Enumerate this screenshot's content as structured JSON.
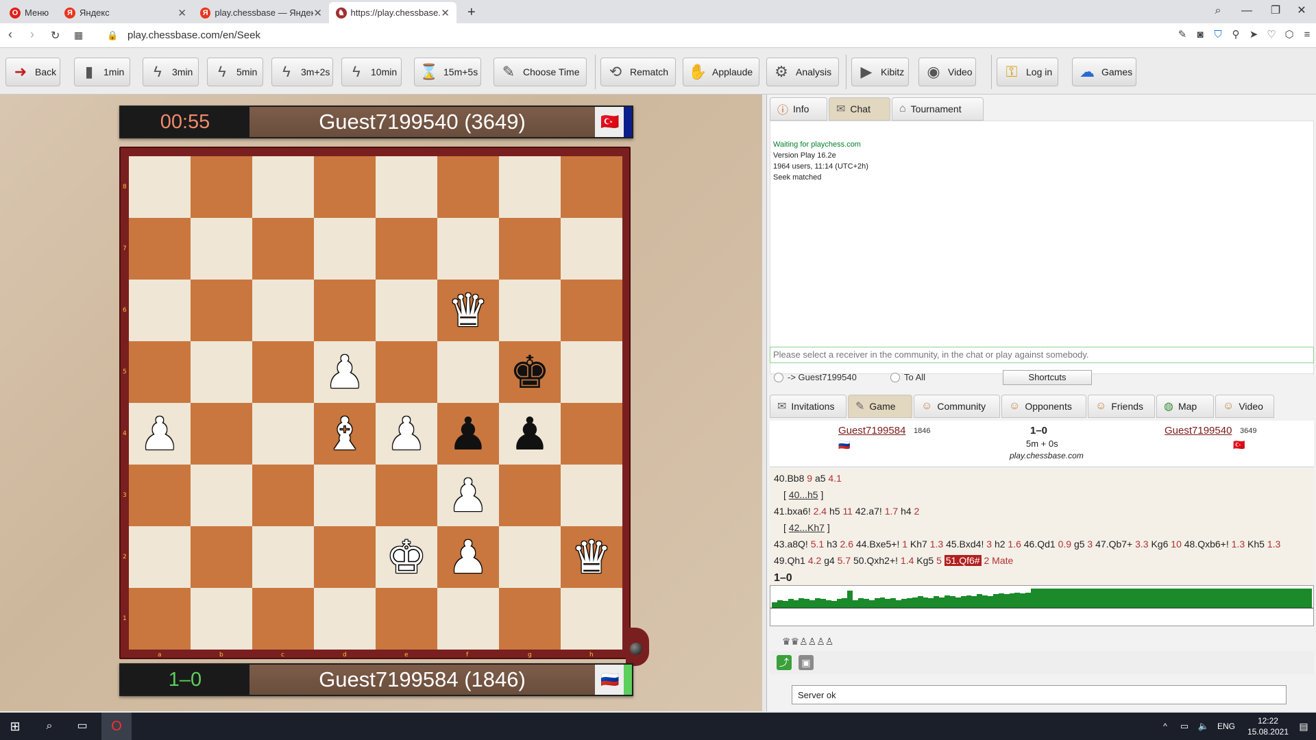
{
  "browser": {
    "menu_label": "Меню",
    "tabs": [
      {
        "label": "Яндекс"
      },
      {
        "label": "play.chessbase — Яндекс: н"
      },
      {
        "label": "https://play.chessbase.com"
      }
    ],
    "url": "play.chessbase.com/en/Seek"
  },
  "toolbar": {
    "back": "Back",
    "t1": "1min",
    "t3": "3min",
    "t5": "5min",
    "t32": "3m+2s",
    "t10": "10min",
    "t15": "15m+5s",
    "choose": "Choose Time",
    "rematch": "Rematch",
    "applaude": "Applaude",
    "analysis": "Analysis",
    "kibitz": "Kibitz",
    "video": "Video",
    "login": "Log in",
    "games": "Games"
  },
  "board": {
    "top_player": {
      "clock": "00:55",
      "name": "Guest7199540 (3649)",
      "flag": "🇹🇷",
      "strip_color": "#0b1f8c",
      "clock_color": "#f08a6a"
    },
    "bottom_player": {
      "clock": "1–0",
      "name": "Guest7199584 (1846)",
      "flag": "🇷🇺",
      "strip_color": "#5ccf5c",
      "clock_color": "#5ccf5c"
    },
    "ranks": [
      "8",
      "7",
      "6",
      "5",
      "4",
      "3",
      "2",
      "1"
    ],
    "files": [
      "a",
      "b",
      "c",
      "d",
      "e",
      "f",
      "g",
      "h"
    ],
    "pieces": [
      {
        "sq": "f6",
        "glyph": "♛",
        "color": "w"
      },
      {
        "sq": "d5",
        "glyph": "♟",
        "color": "w"
      },
      {
        "sq": "g5",
        "glyph": "♚",
        "color": "b"
      },
      {
        "sq": "a4",
        "glyph": "♟",
        "color": "w"
      },
      {
        "sq": "d4",
        "glyph": "♝",
        "color": "w"
      },
      {
        "sq": "e4",
        "glyph": "♟",
        "color": "w"
      },
      {
        "sq": "f4",
        "glyph": "♟",
        "color": "b"
      },
      {
        "sq": "g4",
        "glyph": "♟",
        "color": "b"
      },
      {
        "sq": "f3",
        "glyph": "♟",
        "color": "w"
      },
      {
        "sq": "e2",
        "glyph": "♚",
        "color": "w"
      },
      {
        "sq": "f2",
        "glyph": "♟",
        "color": "w"
      },
      {
        "sq": "h2",
        "glyph": "♛",
        "color": "w"
      }
    ]
  },
  "panel": {
    "tabs": {
      "info": "Info",
      "chat": "Chat",
      "tournament": "Tournament"
    },
    "chat_lines": [
      "Waiting for playchess.com",
      "Version Play 16.2e",
      "1964 users, 11:14 (UTC+2h)",
      "Seek matched"
    ],
    "chat_placeholder": "Please select a receiver in the community, in the chat or play against somebody.",
    "radio_guest": "-> Guest7199540",
    "radio_all": "To All",
    "shortcuts": "Shortcuts",
    "tabs2": {
      "invitations": "Invitations",
      "game": "Game",
      "community": "Community",
      "opponents": "Opponents",
      "friends": "Friends",
      "map": "Map",
      "video": "Video"
    },
    "game": {
      "white": "Guest7199584",
      "white_elo": "1846",
      "black": "Guest7199540",
      "black_elo": "3649",
      "result": "1–0",
      "timecontrol": "5m + 0s",
      "site": "play.chessbase.com"
    },
    "moves": {
      "l1": "40.Bb8",
      "l1e1": "9",
      "l1b": "a5",
      "l1e2": "4.1",
      "v1": "40...h5",
      "l2a": "41.bxa6!",
      "l2e1": "2.4",
      "l2b": "h5",
      "l2e2": "11",
      "l2c": "42.a7!",
      "l2e3": "1.7",
      "l2d": "h4",
      "l2e4": "2",
      "v2": "42...Kh7",
      "l3a": "43.a8Q!",
      "l3e1": "5.1",
      "l3b": "h3",
      "l3e2": "2.6",
      "l3c": "44.Bxe5+!",
      "l3e3": "1",
      "l3d": "Kh7",
      "l3e4": "1.3",
      "l3f": "45.Bxd4!",
      "l3e5": "3",
      "l3g": "h2",
      "l3e6": "1.6",
      "l3h": "46.Qd1",
      "l3e7": "0.9",
      "l3i": "g5",
      "l3e8": "3",
      "l3j": "47.Qb7+",
      "l3e9": "3.3",
      "l3k": "Kg6",
      "l3e10": "10",
      "l3l": "48.Qxb6+!",
      "l3e11": "1.3",
      "l3m": "Kh5",
      "l4e0": "1.3",
      "l4a": "49.Qh1",
      "l4e1": "4.2",
      "l4b": "g4",
      "l4e2": "5.7",
      "l4c": "50.Qxh2+!",
      "l4e3": "1.4",
      "l4d": "Kg5",
      "l4e4": "5",
      "l4cur": "51.Qf6#",
      "l4e5": "2",
      "l4mate": "Mate",
      "result": "1–0"
    },
    "eval_bars": [
      0.3,
      0.4,
      0.35,
      0.45,
      0.4,
      0.5,
      0.45,
      0.4,
      0.5,
      0.45,
      0.4,
      0.35,
      0.45,
      0.5,
      0.9,
      0.4,
      0.5,
      0.45,
      0.4,
      0.5,
      0.55,
      0.45,
      0.5,
      0.4,
      0.45,
      0.5,
      0.55,
      0.6,
      0.55,
      0.5,
      0.6,
      0.55,
      0.65,
      0.6,
      0.55,
      0.6,
      0.65,
      0.6,
      0.7,
      0.65,
      0.6,
      0.7,
      0.75,
      0.7,
      0.75,
      0.8,
      0.75,
      0.8,
      1,
      1,
      1,
      1,
      1,
      1,
      1,
      1,
      1,
      1,
      1,
      1,
      1,
      1,
      1,
      1,
      1,
      1,
      1,
      1,
      1,
      1,
      1,
      1,
      1,
      1,
      1,
      1,
      1,
      1,
      1,
      1,
      1,
      1,
      1,
      1,
      1,
      1,
      1,
      1,
      1,
      1,
      1,
      1,
      1,
      1,
      1,
      1,
      1,
      1,
      1,
      1
    ],
    "material": "♛♛♙♙♙♙",
    "status": "Server ok"
  },
  "taskbar": {
    "lang": "ENG",
    "time": "12:22",
    "date": "15.08.2021"
  }
}
